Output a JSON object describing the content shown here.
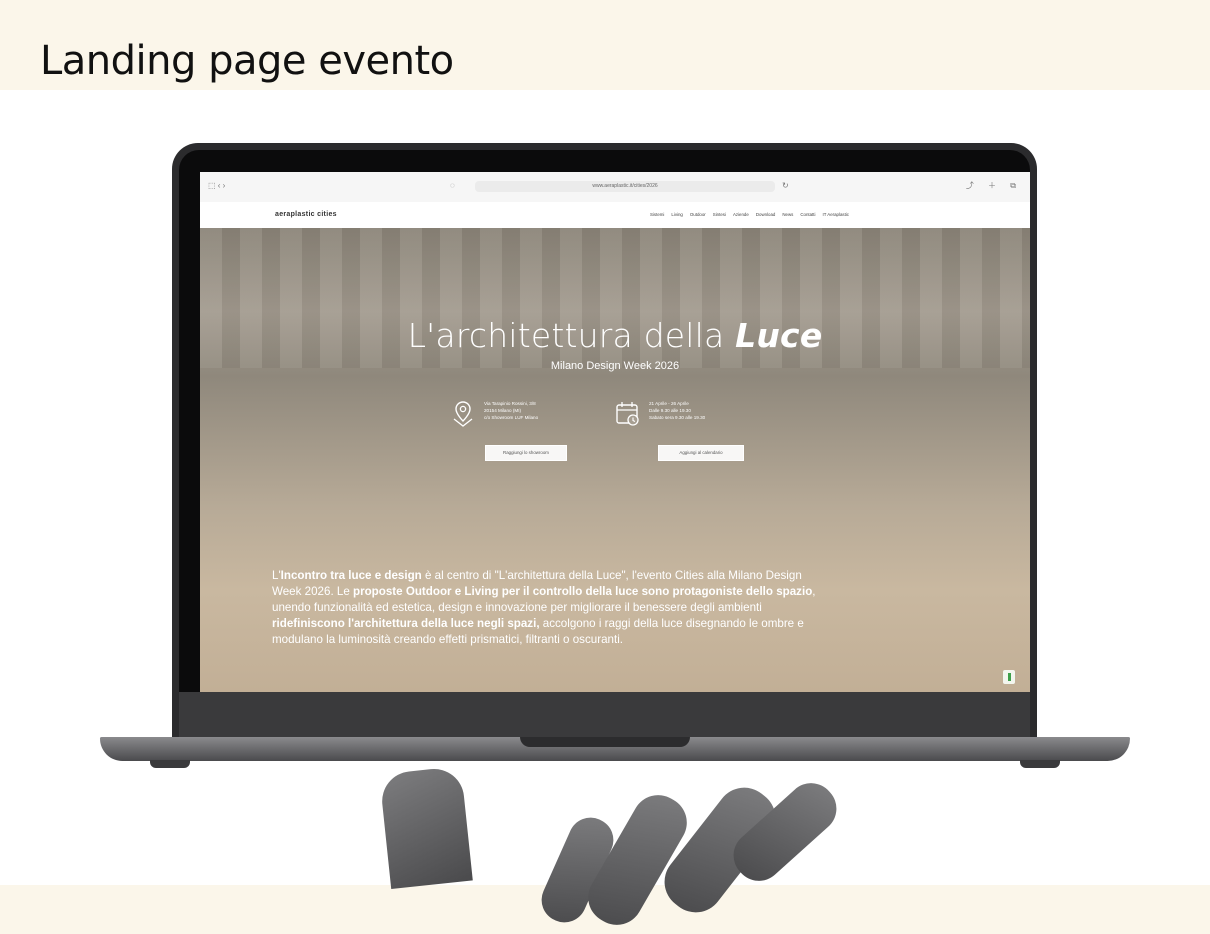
{
  "page": {
    "heading": "Landing page evento"
  },
  "browser": {
    "url": "www.aeraplastic.it/cities/2026",
    "nav_controls": "⬚ ‹ ›",
    "toolbar_icons": "⤴ ＋ ⧉"
  },
  "site": {
    "logo": "aeraplastic  cities",
    "nav": [
      "Sistemi",
      "Living",
      "Outdoor",
      "Sintesi",
      "Aziende",
      "Download",
      "News",
      "Contatti",
      "IT Aeraplastic"
    ]
  },
  "hero": {
    "title_prefix": "L'architettura della ",
    "title_emphasis": "Luce",
    "subtitle": "Milano Design Week 2026",
    "location_lines": [
      "Via Tarapinio Rossini, 3/8",
      "20154 Milano (MI)",
      "c/o Showroom LUF Milano"
    ],
    "date_lines": [
      "21 Aprile - 26 Aprile",
      "Dalle 9.30 alle 19.30",
      "Sabato sera 9.30 alle 19.30"
    ],
    "button_map": "Raggiungi lo showroom",
    "button_calendar": "Aggiungi al calendario",
    "intro": {
      "p1": "L'",
      "p2": "Incontro tra luce e design",
      "p3": " è al centro di \"L'architettura della Luce\", l'evento Cities alla Milano Design Week 2026. Le ",
      "p4": "proposte Outdoor e Living per il controllo della luce sono protagoniste dello spazio",
      "p5": ", unendo funzionalità ed estetica, design e innovazione per migliorare il benessere degli ambienti ",
      "p6": "ridefiniscono l'architettura della luce negli spazi,",
      "p7": " accolgono i raggi della luce disegnando le ombre e modulano la luminosità creando effetti prismatici, filtranti o oscuranti."
    }
  }
}
